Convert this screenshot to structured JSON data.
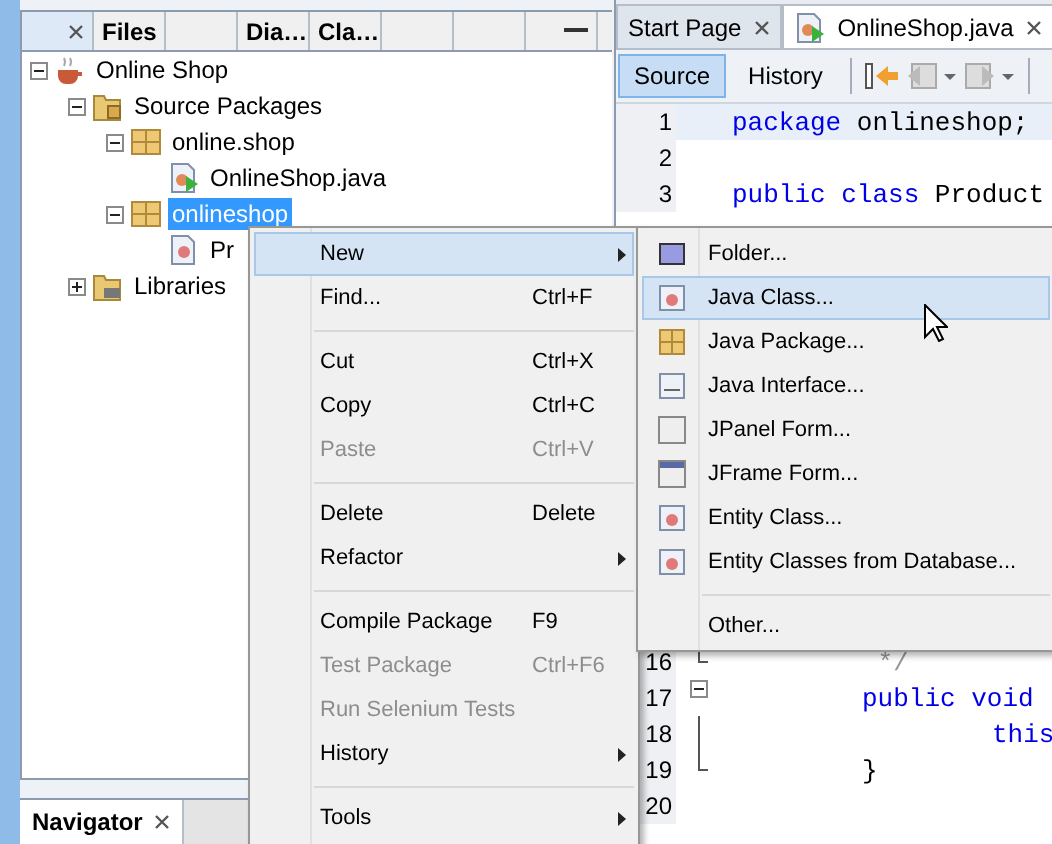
{
  "projects_panel": {
    "tabs": [
      {
        "kind": "close",
        "selected": true
      },
      {
        "kind": "label",
        "label": "Files",
        "selected": false
      },
      {
        "kind": "blank"
      },
      {
        "kind": "label",
        "label": "Dia…",
        "selected": false
      },
      {
        "kind": "label",
        "label": "Cla…",
        "selected": false
      },
      {
        "kind": "blank"
      },
      {
        "kind": "blank"
      },
      {
        "kind": "minimize",
        "selected": false
      }
    ],
    "tree": [
      {
        "label": "Online Shop",
        "kind": "project",
        "expanded": true,
        "selected": false,
        "children": [
          {
            "label": "Source Packages",
            "kind": "source-folder",
            "expanded": true,
            "selected": false,
            "children": [
              {
                "label": "online.shop",
                "kind": "package",
                "expanded": true,
                "selected": false,
                "children": [
                  {
                    "label": "OnlineShop.java",
                    "kind": "java-main",
                    "selected": false
                  }
                ]
              },
              {
                "label": "onlineshop",
                "kind": "package",
                "expanded": true,
                "selected": true,
                "children": [
                  {
                    "label": "Pr",
                    "kind": "java-class",
                    "selected": false
                  }
                ]
              }
            ]
          },
          {
            "label": "Libraries",
            "kind": "library",
            "expanded": false,
            "selected": false
          }
        ]
      }
    ]
  },
  "navigator": {
    "tab": "Navigator"
  },
  "editor": {
    "tabs": [
      {
        "label": "Start Page",
        "kind": "page",
        "selected": false
      },
      {
        "label": "OnlineShop.java",
        "kind": "java-main",
        "selected": true
      }
    ],
    "views": [
      {
        "label": "Source",
        "selected": true
      },
      {
        "label": "History",
        "selected": false
      }
    ],
    "lines_top": [
      {
        "number": "1",
        "kind": "top",
        "current": true,
        "tokens": [
          {
            "text": "package ",
            "kind": "keyword"
          },
          {
            "text": "onlineshop;",
            "kind": "plain"
          }
        ]
      },
      {
        "number": "2",
        "kind": "blank",
        "current": false
      },
      {
        "number": "3",
        "kind": "top",
        "current": false,
        "tokens": [
          {
            "text": "public class ",
            "kind": "keyword"
          },
          {
            "text": "Product",
            "kind": "plain"
          }
        ]
      }
    ],
    "lines_bottom": [
      {
        "number": "16",
        "kind": "member-end",
        "current": false,
        "tokens": [
          {
            "text": " */",
            "kind": "comment"
          }
        ]
      },
      {
        "number": "17",
        "kind": "member-open",
        "current": false,
        "tokens": [
          {
            "text": "public void",
            "kind": "keyword"
          }
        ]
      },
      {
        "number": "18",
        "kind": "body-line",
        "current": false,
        "tokens": [
          {
            "text": "this",
            "kind": "keyword"
          }
        ]
      },
      {
        "number": "19",
        "kind": "member-end",
        "current": false,
        "tokens": [
          {
            "text": "}",
            "kind": "plain"
          }
        ]
      },
      {
        "number": "20",
        "kind": "blank",
        "current": false
      }
    ]
  },
  "context_menu": {
    "items": [
      {
        "kind": "item",
        "label": "New",
        "submenu": true,
        "selected": true,
        "disabled": false
      },
      {
        "kind": "item",
        "label": "Find...",
        "shortcut": "Ctrl+F",
        "submenu": false,
        "selected": false,
        "disabled": false
      },
      {
        "kind": "separator"
      },
      {
        "kind": "item",
        "label": "Cut",
        "shortcut": "Ctrl+X",
        "submenu": false,
        "selected": false,
        "disabled": false
      },
      {
        "kind": "item",
        "label": "Copy",
        "shortcut": "Ctrl+C",
        "submenu": false,
        "selected": false,
        "disabled": false
      },
      {
        "kind": "item",
        "label": "Paste",
        "shortcut": "Ctrl+V",
        "submenu": false,
        "selected": false,
        "disabled": true
      },
      {
        "kind": "separator"
      },
      {
        "kind": "item",
        "label": "Delete",
        "shortcut": "Delete",
        "submenu": false,
        "selected": false,
        "disabled": false
      },
      {
        "kind": "item",
        "label": "Refactor",
        "submenu": true,
        "selected": false,
        "disabled": false
      },
      {
        "kind": "separator"
      },
      {
        "kind": "item",
        "label": "Compile Package",
        "shortcut": "F9",
        "submenu": false,
        "selected": false,
        "disabled": false
      },
      {
        "kind": "item",
        "label": "Test Package",
        "shortcut": "Ctrl+F6",
        "submenu": false,
        "selected": false,
        "disabled": true
      },
      {
        "kind": "item",
        "label": "Run Selenium Tests",
        "submenu": false,
        "selected": false,
        "disabled": true
      },
      {
        "kind": "item",
        "label": "History",
        "submenu": true,
        "selected": false,
        "disabled": false
      },
      {
        "kind": "separator"
      },
      {
        "kind": "item",
        "label": "Tools",
        "submenu": true,
        "selected": false,
        "disabled": false
      }
    ]
  },
  "new_submenu": {
    "items": [
      {
        "kind": "folder",
        "label": "Folder...",
        "selected": false
      },
      {
        "kind": "class",
        "label": "Java Class...",
        "selected": true
      },
      {
        "kind": "package",
        "label": "Java Package...",
        "selected": false
      },
      {
        "kind": "interface",
        "label": "Java Interface...",
        "selected": false
      },
      {
        "kind": "panel",
        "label": "JPanel Form...",
        "selected": false
      },
      {
        "kind": "frame",
        "label": "JFrame Form...",
        "selected": false
      },
      {
        "kind": "class",
        "label": "Entity Class...",
        "selected": false
      },
      {
        "kind": "class",
        "label": "Entity Classes from Database...",
        "selected": false
      },
      {
        "kind": "separator"
      },
      {
        "kind": "plain",
        "label": "Other...",
        "selected": false
      }
    ]
  }
}
